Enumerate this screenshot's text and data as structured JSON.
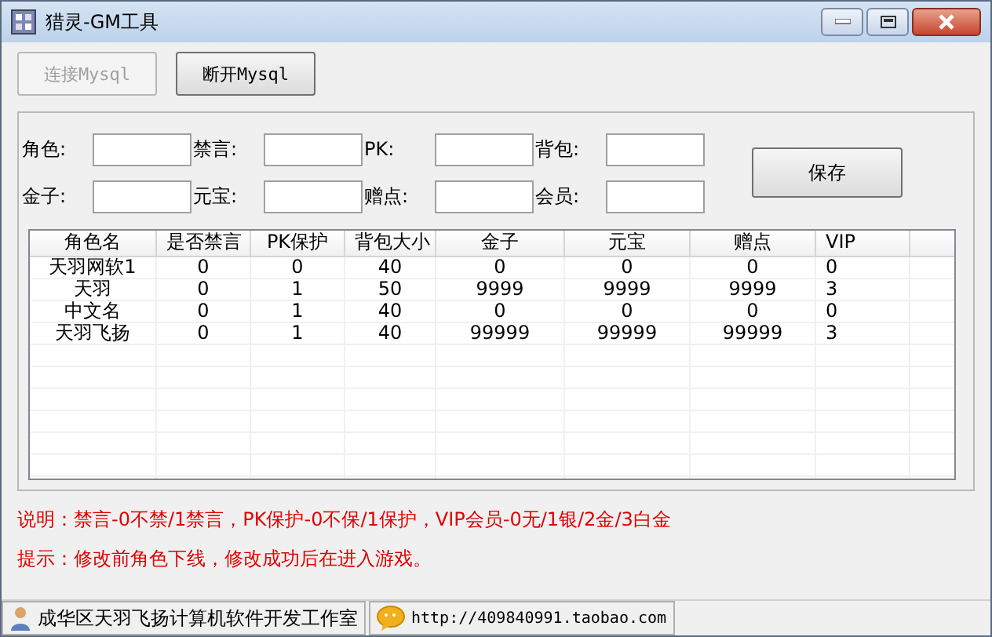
{
  "window": {
    "title": "猎灵-GM工具"
  },
  "buttons": [
    {
      "label": "连接Mysql",
      "disabled": true
    },
    {
      "label": "断开Mysql",
      "disabled": false
    }
  ],
  "fields": [
    {
      "label": "角色:"
    },
    {
      "label": "禁言:"
    },
    {
      "label": "PK:"
    },
    {
      "label": "背包:"
    },
    {
      "label": "金子:"
    },
    {
      "label": "元宝:"
    },
    {
      "label": "赠点:"
    },
    {
      "label": "会员:"
    }
  ],
  "save_button": "保存",
  "table": {
    "columns": [
      "角色名",
      "是否禁言",
      "PK保护",
      "背包大小",
      "金子",
      "元宝",
      "赠点",
      "VIP"
    ],
    "rows": [
      [
        "天羽网软1",
        "0",
        "0",
        "40",
        "0",
        "0",
        "0",
        "0"
      ],
      [
        "天羽",
        "0",
        "1",
        "50",
        "9999",
        "9999",
        "9999",
        "3"
      ],
      [
        "中文名",
        "0",
        "1",
        "40",
        "0",
        "0",
        "0",
        "0"
      ],
      [
        "天羽飞扬",
        "0",
        "1",
        "40",
        "99999",
        "99999",
        "99999",
        "3"
      ]
    ]
  },
  "notes": [
    "说明：禁言-0不禁/1禁言，PK保护-0不保/1保护，VIP会员-0无/1银/2金/3白金",
    "提示：修改前角色下线，修改成功后在进入游戏。"
  ],
  "status_bar": [
    {
      "kind": "person",
      "text": "成华区天羽飞扬计算机软件开发工作室"
    },
    {
      "kind": "chat",
      "text": "http://409840991.taobao.com"
    }
  ]
}
